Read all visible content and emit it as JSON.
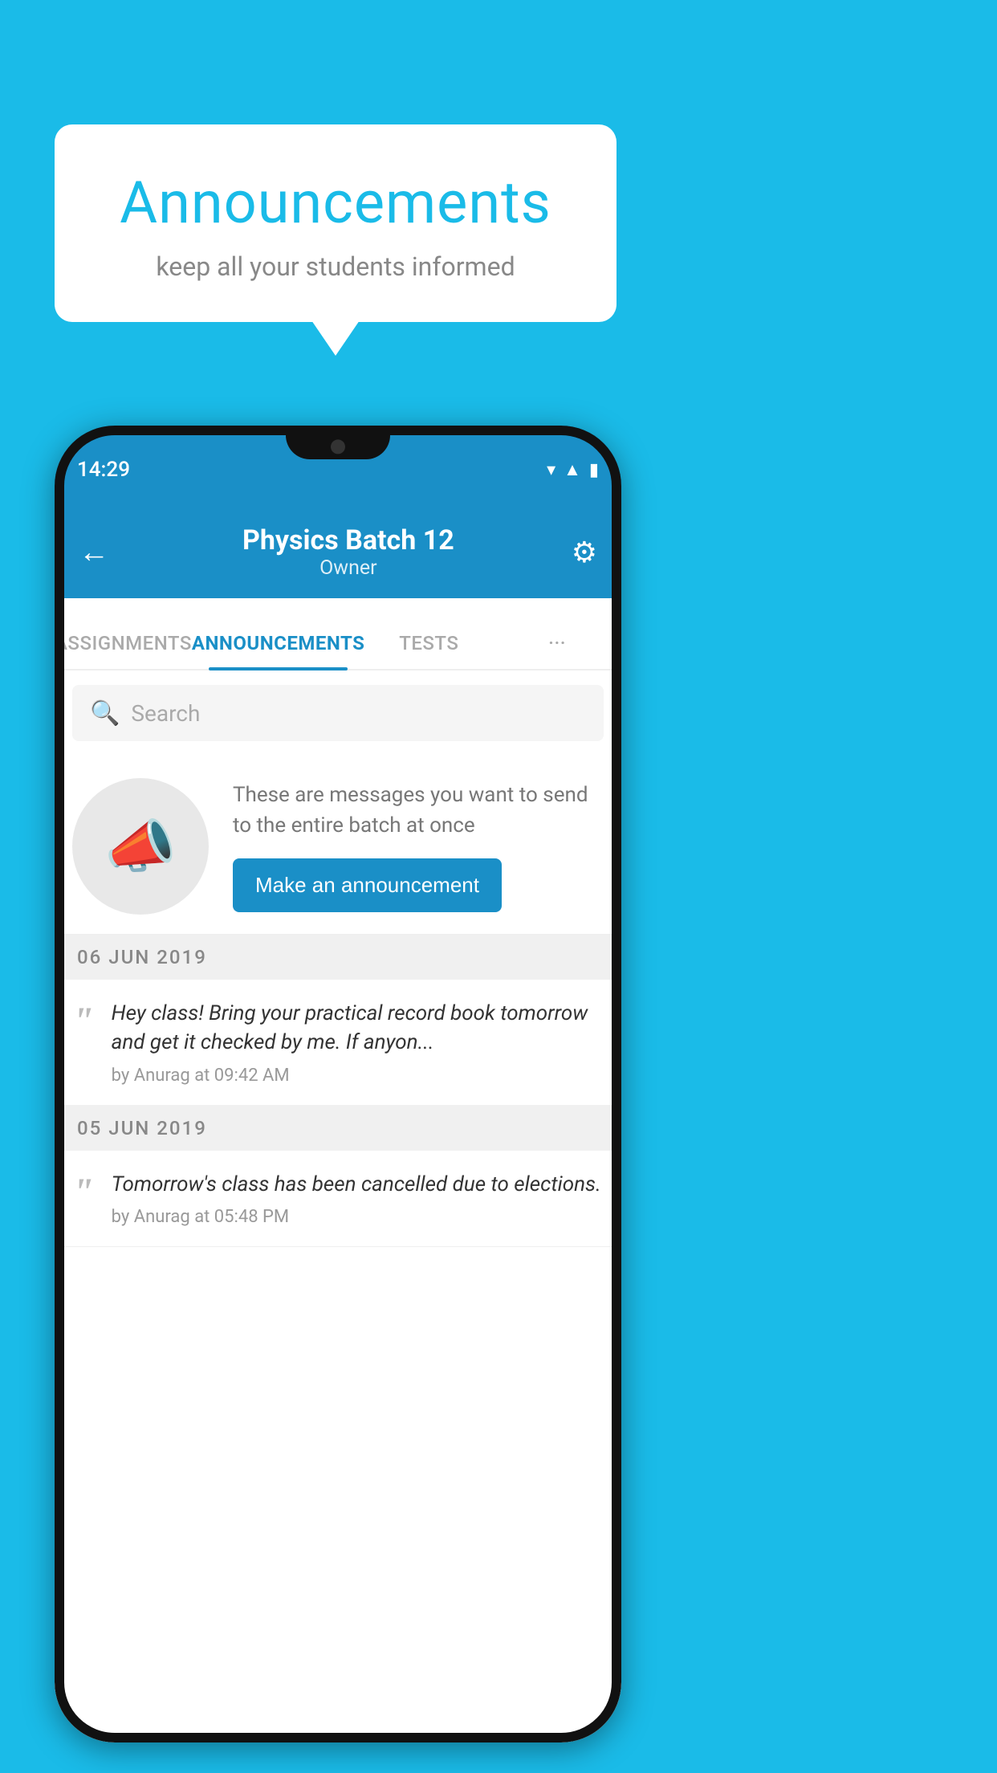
{
  "background_color": "#1ABBE8",
  "speech_bubble": {
    "title": "Announcements",
    "subtitle": "keep all your students informed"
  },
  "app_bar": {
    "title": "Physics Batch 12",
    "subtitle": "Owner",
    "back_label": "←",
    "gear_label": "⚙"
  },
  "tabs": [
    {
      "label": "ASSIGNMENTS",
      "active": false
    },
    {
      "label": "ANNOUNCEMENTS",
      "active": true
    },
    {
      "label": "TESTS",
      "active": false
    },
    {
      "label": "···",
      "active": false
    }
  ],
  "search": {
    "placeholder": "Search"
  },
  "cta": {
    "description": "These are messages you want to send to the entire batch at once",
    "button_label": "Make an announcement"
  },
  "status_bar": {
    "time": "14:29"
  },
  "announcements": [
    {
      "date": "06  JUN  2019",
      "message": "Hey class! Bring your practical record book tomorrow and get it checked by me. If anyon...",
      "by": "by Anurag at 09:42 AM"
    },
    {
      "date": "05  JUN  2019",
      "message": "Tomorrow's class has been cancelled due to elections.",
      "by": "by Anurag at 05:48 PM"
    }
  ]
}
